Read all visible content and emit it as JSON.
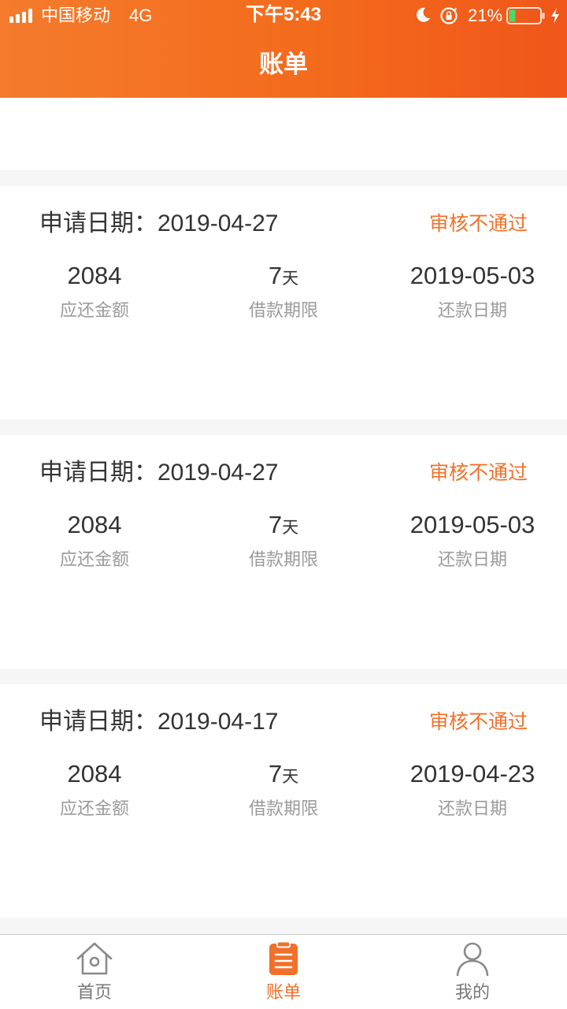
{
  "status_bar": {
    "carrier": "中国移动",
    "network": "4G",
    "time": "下午5:43",
    "battery_percent": "21%",
    "battery_level": 0.21,
    "icons": [
      "signal-icon",
      "moon-icon",
      "orientation-lock-icon",
      "battery-icon",
      "charging-bolt-icon"
    ]
  },
  "header": {
    "title": "账单"
  },
  "bills": [
    {
      "apply_label": "申请日期：",
      "apply_date": "2019-04-27",
      "status": "审核不通过",
      "amount": "2084",
      "amount_label": "应还金额",
      "term_value": "7",
      "term_unit": "天",
      "term_label": "借款期限",
      "repay_date": "2019-05-03",
      "repay_label": "还款日期"
    },
    {
      "apply_label": "申请日期：",
      "apply_date": "2019-04-27",
      "status": "审核不通过",
      "amount": "2084",
      "amount_label": "应还金额",
      "term_value": "7",
      "term_unit": "天",
      "term_label": "借款期限",
      "repay_date": "2019-05-03",
      "repay_label": "还款日期"
    },
    {
      "apply_label": "申请日期：",
      "apply_date": "2019-04-17",
      "status": "审核不通过",
      "amount": "2084",
      "amount_label": "应还金额",
      "term_value": "7",
      "term_unit": "天",
      "term_label": "借款期限",
      "repay_date": "2019-04-23",
      "repay_label": "还款日期"
    }
  ],
  "tab_bar": {
    "items": [
      {
        "label": "首页",
        "icon": "home-icon",
        "active": false
      },
      {
        "label": "账单",
        "icon": "bill-icon",
        "active": true
      },
      {
        "label": "我的",
        "icon": "user-icon",
        "active": false
      }
    ]
  },
  "colors": {
    "brand_orange": "#f36b1c",
    "status_text": "#f1702a",
    "label_gray": "#9a9a9a",
    "text_dark": "#333333"
  }
}
